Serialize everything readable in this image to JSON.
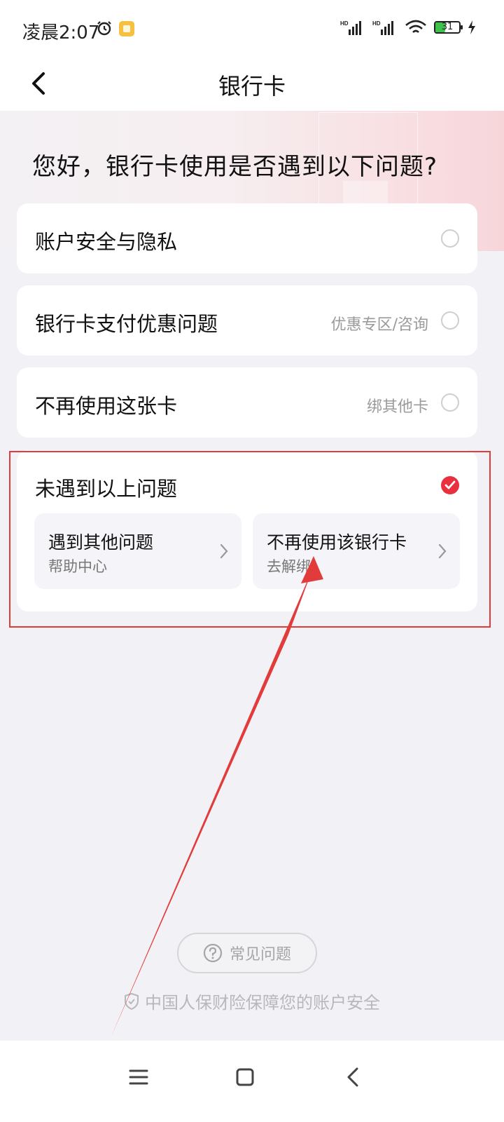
{
  "status_bar": {
    "time": "凌晨2:07",
    "signal1_label": "HD",
    "signal2_label": "HD",
    "battery_level": "31",
    "icons": [
      "alarm-icon",
      "app-notification-icon",
      "signal-icon",
      "signal-icon",
      "wifi-icon",
      "battery-icon",
      "charging-icon"
    ]
  },
  "nav": {
    "title": "银行卡",
    "back_icon": "chevron-left-icon"
  },
  "question": "您好，银行卡使用是否遇到以下问题?",
  "options": [
    {
      "label": "账户安全与隐私",
      "hint": "",
      "checked": false
    },
    {
      "label": "银行卡支付优惠问题",
      "hint": "优惠专区/咨询",
      "checked": false
    },
    {
      "label": "不再使用这张卡",
      "hint": "绑其他卡",
      "checked": false
    },
    {
      "label": "未遇到以上问题",
      "hint": "",
      "checked": true
    }
  ],
  "sub_options": [
    {
      "title": "遇到其他问题",
      "desc": "帮助中心"
    },
    {
      "title": "不再使用该银行卡",
      "desc": "去解绑"
    }
  ],
  "faq": {
    "label": "常见问题",
    "icon": "question-circle-icon"
  },
  "security_note": "中国人保财险保障您的账户安全",
  "colors": {
    "accent_red": "#e8303e",
    "annotation_red": "#e23b3b",
    "background": "#f2f2f6"
  },
  "system_nav": [
    "menu-icon",
    "home-icon",
    "back-icon"
  ]
}
